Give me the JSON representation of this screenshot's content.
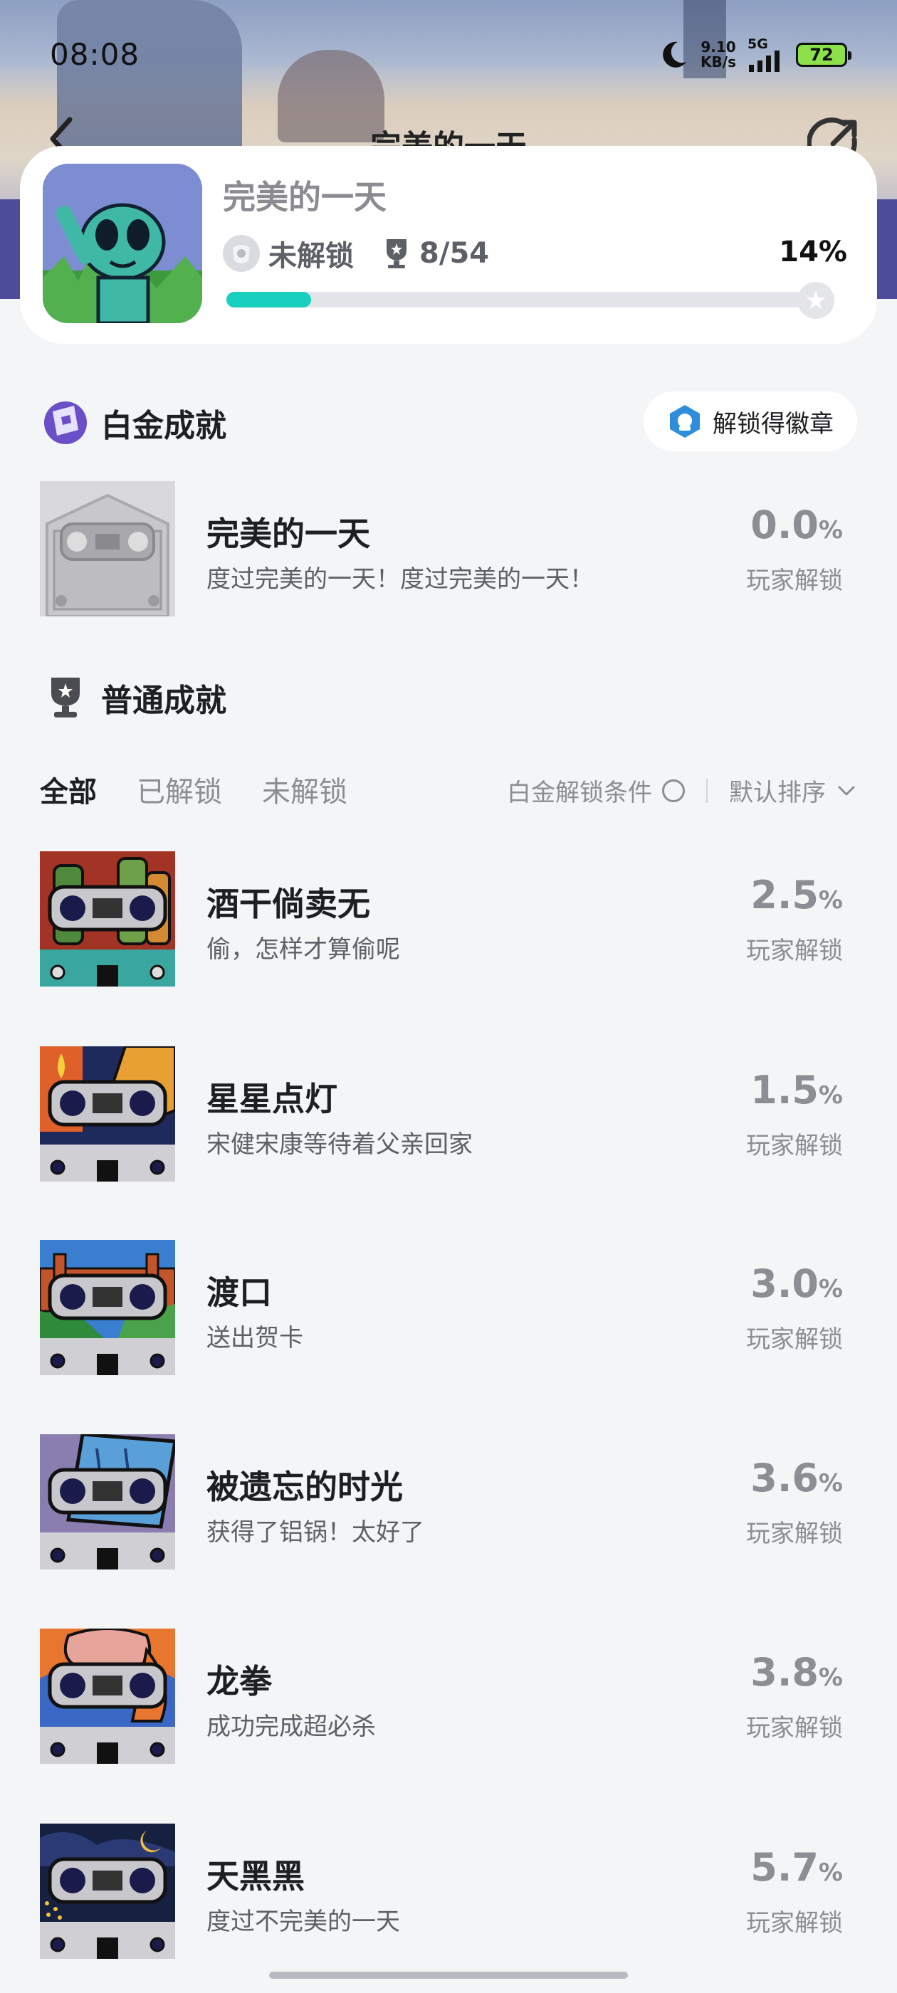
{
  "status_bar": {
    "time": "08:08",
    "net_speed_value": "9.10",
    "net_speed_unit": "KB/s",
    "network": "5G",
    "battery": "72"
  },
  "nav": {
    "title": "完美的一天"
  },
  "game": {
    "name": "完美的一天",
    "lock_status": "未解锁",
    "trophy_count": "8/54",
    "percent_label": "14%",
    "progress": 0.14
  },
  "platinum": {
    "section_title": "白金成就",
    "badge_button": "解锁得徽章",
    "item": {
      "name": "完美的一天",
      "desc": "度过完美的一天！度过完美的一天！",
      "pct": "0.0",
      "pct_unit": "%",
      "sub": "玩家解锁"
    }
  },
  "normal": {
    "section_title": "普通成就",
    "tabs": [
      "全部",
      "已解锁",
      "未解锁"
    ],
    "filter_label": "白金解锁条件",
    "sort_label": "默认排序",
    "items": [
      {
        "name": "酒干倘卖无",
        "desc": "偷，怎样才算偷呢",
        "pct": "2.5",
        "unit": "%",
        "sub": "玩家解锁"
      },
      {
        "name": "星星点灯",
        "desc": "宋健宋康等待着父亲回家",
        "pct": "1.5",
        "unit": "%",
        "sub": "玩家解锁"
      },
      {
        "name": "渡口",
        "desc": "送出贺卡",
        "pct": "3.0",
        "unit": "%",
        "sub": "玩家解锁"
      },
      {
        "name": "被遗忘的时光",
        "desc": "获得了铝锅！太好了",
        "pct": "3.6",
        "unit": "%",
        "sub": "玩家解锁"
      },
      {
        "name": "龙拳",
        "desc": "成功完成超必杀",
        "pct": "3.8",
        "unit": "%",
        "sub": "玩家解锁"
      },
      {
        "name": "天黑黑",
        "desc": "度过不完美的一天",
        "pct": "5.7",
        "unit": "%",
        "sub": "玩家解锁"
      }
    ]
  }
}
